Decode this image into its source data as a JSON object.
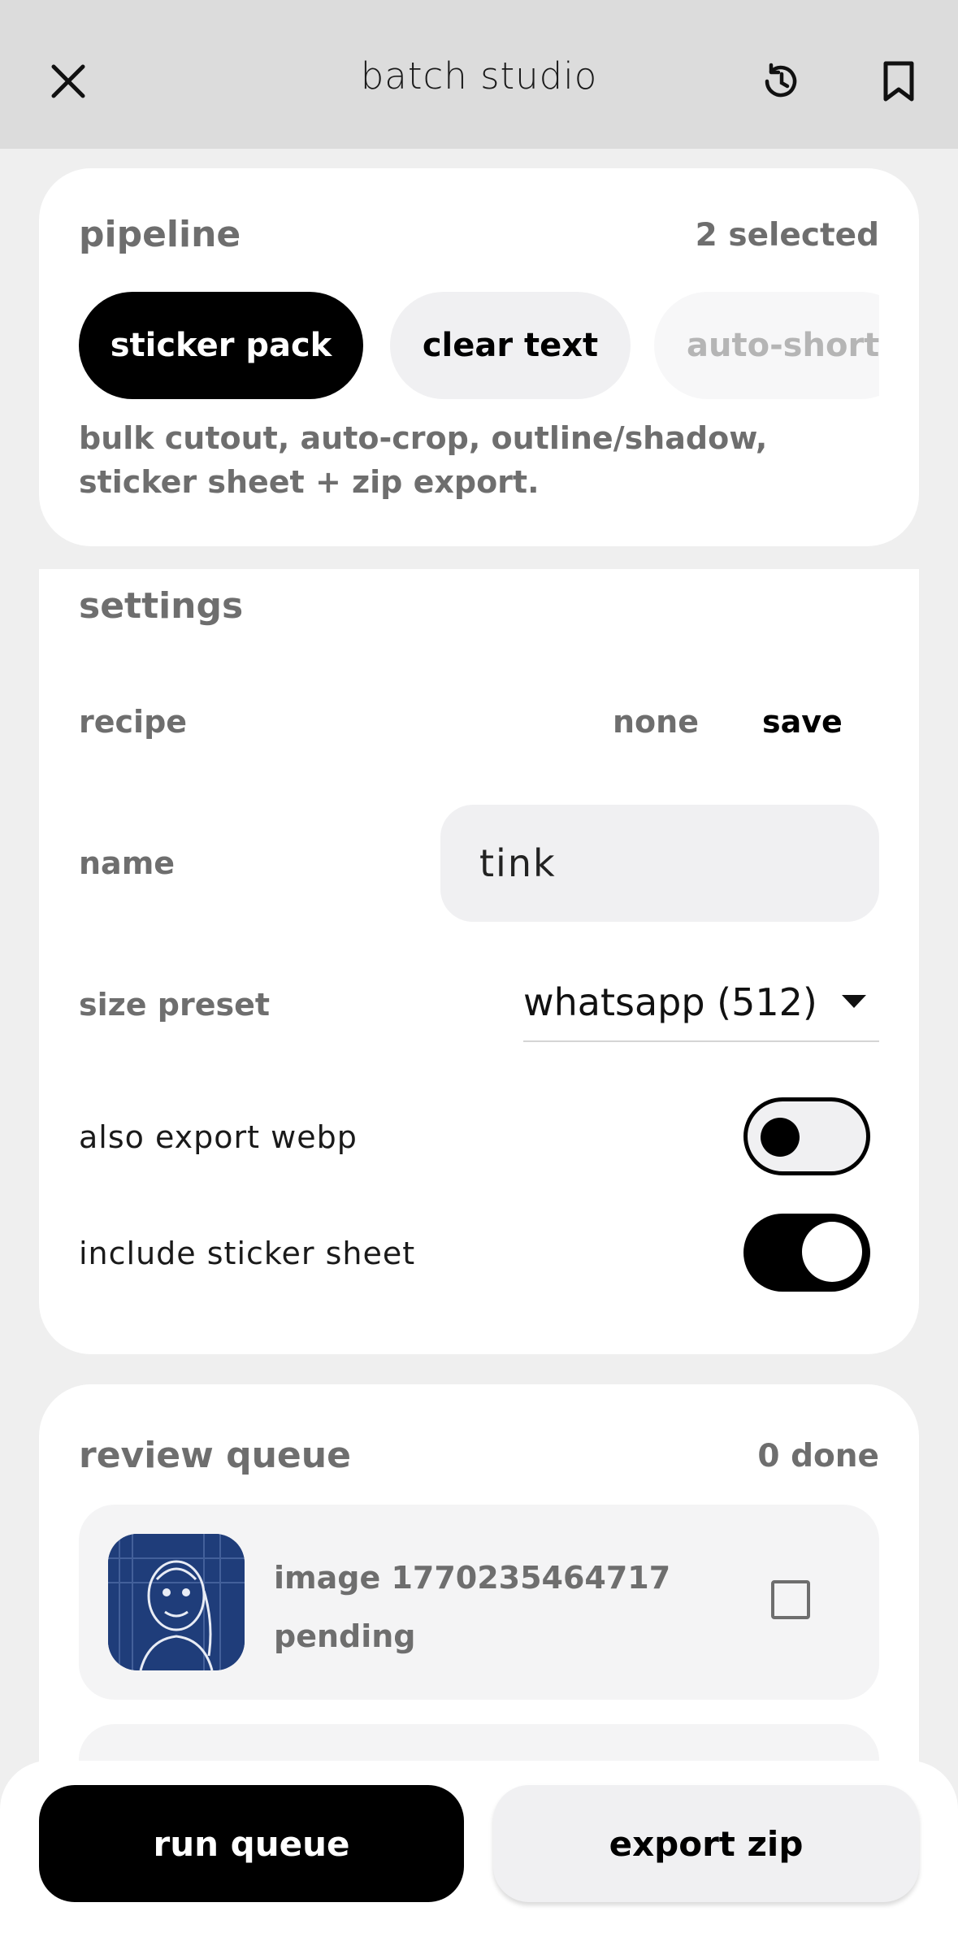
{
  "header": {
    "title": "batch studio",
    "icons": [
      "close-icon",
      "history-icon",
      "bookmark-icon"
    ]
  },
  "pipeline": {
    "title": "pipeline",
    "selected_count": "2 selected",
    "chips": [
      {
        "label": "sticker pack",
        "state": "active"
      },
      {
        "label": "clear text",
        "state": "inactive"
      },
      {
        "label": "auto-short",
        "state": "faded"
      }
    ],
    "description": "bulk cutout, auto-crop, outline/shadow, sticker sheet + zip export."
  },
  "settings": {
    "title": "settings",
    "recipe_label": "recipe",
    "recipe_none": "none",
    "recipe_save": "save",
    "name_label": "name",
    "name_value": "tink",
    "size_label": "size preset",
    "size_value": "whatsapp (512)",
    "webp_label": "also export webp",
    "webp_on": false,
    "sheet_label": "include sticker sheet",
    "sheet_on": true
  },
  "review": {
    "title": "review queue",
    "done_count": "0 done",
    "items": [
      {
        "name": "image 1770235464717",
        "status": "pending",
        "checked": false
      }
    ]
  },
  "actions": {
    "run_label": "run queue",
    "export_label": "export zip"
  },
  "colors": {
    "accent": "#000000",
    "chip_inactive": "#f0f0f2",
    "muted_text": "#6e6e6e",
    "thumbnail_blue": "#1f3d7a"
  }
}
